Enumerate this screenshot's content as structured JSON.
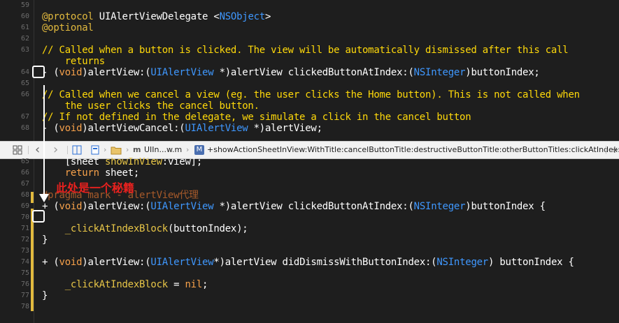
{
  "annotation": "此处是一个秘籍",
  "jumpbar": {
    "back": "‹",
    "forward": "›",
    "file_icon_letter": "m",
    "file": "UIIn...w.m",
    "method_icon_letter": "M",
    "method": "+showActionSheetInView:WithTitle:cancelButtonTitle:destructiveButtonTitle:otherButtonTitles:clickAtIndex:",
    "add": "+"
  },
  "top_lines": [
    {
      "n": "59",
      "t": []
    },
    {
      "n": "60",
      "t": [
        [
          "pp",
          "@protocol "
        ],
        [
          "pl",
          "UIAlertViewDelegate <"
        ],
        [
          "ty",
          "NSObject"
        ],
        [
          "pl",
          ">"
        ]
      ]
    },
    {
      "n": "61",
      "t": [
        [
          "pp",
          "@optional"
        ]
      ]
    },
    {
      "n": "62",
      "t": []
    },
    {
      "n": "63",
      "t": [
        [
          "cm",
          "// Called when a button is clicked. The view will be automatically dismissed after this call"
        ]
      ]
    },
    {
      "n": "",
      "t": [
        [
          "cm",
          "    returns"
        ]
      ]
    },
    {
      "n": "64",
      "t": [
        [
          "pl",
          "- ("
        ],
        [
          "kw",
          "void"
        ],
        [
          "pl",
          ")alertView:("
        ],
        [
          "ty",
          "UIAlertView"
        ],
        [
          "pl",
          " *)alertView clickedButtonAtIndex:("
        ],
        [
          "ty",
          "NSInteger"
        ],
        [
          "pl",
          ")buttonIndex;"
        ]
      ]
    },
    {
      "n": "65",
      "t": []
    },
    {
      "n": "66",
      "t": [
        [
          "cm",
          "// Called when we cancel a view (eg. the user clicks the Home button). This is not called when"
        ]
      ]
    },
    {
      "n": "",
      "t": [
        [
          "cm",
          "    the user clicks the cancel button."
        ]
      ]
    },
    {
      "n": "67",
      "t": [
        [
          "cm",
          "// If not defined in the delegate, we simulate a click in the cancel button"
        ]
      ]
    },
    {
      "n": "68",
      "t": [
        [
          "pl",
          "- ("
        ],
        [
          "kw",
          "void"
        ],
        [
          "pl",
          ")alertViewCancel:("
        ],
        [
          "ty",
          "UIAlertView"
        ],
        [
          "pl",
          " *)alertView;"
        ]
      ]
    }
  ],
  "bottom_lines": [
    {
      "n": "65",
      "t": [
        [
          "pl",
          "    [sheet "
        ],
        [
          "fn",
          "showInView"
        ],
        [
          "pl",
          ":view];"
        ]
      ]
    },
    {
      "n": "66",
      "t": [
        [
          "kw",
          "    return"
        ],
        [
          "pl",
          " sheet;"
        ]
      ]
    },
    {
      "n": "67",
      "t": []
    },
    {
      "n": "68",
      "t": [
        [
          "mk",
          "#pragma mark - alertView代理"
        ]
      ]
    },
    {
      "n": "69",
      "t": [
        [
          "pl",
          "+ ("
        ],
        [
          "kw",
          "void"
        ],
        [
          "pl",
          ")alertView:("
        ],
        [
          "ty",
          "UIAlertView"
        ],
        [
          "pl",
          " *)alertView clickedButtonAtIndex:("
        ],
        [
          "ty",
          "NSInteger"
        ],
        [
          "pl",
          ")buttonIndex {"
        ]
      ]
    },
    {
      "n": "70",
      "t": []
    },
    {
      "n": "71",
      "t": [
        [
          "fn",
          "    _clickAtIndexBlock"
        ],
        [
          "pl",
          "(buttonIndex);"
        ]
      ]
    },
    {
      "n": "72",
      "t": [
        [
          "pl",
          "}"
        ]
      ]
    },
    {
      "n": "73",
      "t": []
    },
    {
      "n": "74",
      "t": [
        [
          "pl",
          "+ ("
        ],
        [
          "kw",
          "void"
        ],
        [
          "pl",
          ")alertView:("
        ],
        [
          "ty",
          "UIAlertView"
        ],
        [
          "pl",
          "*)alertView didDismissWithButtonIndex:("
        ],
        [
          "ty",
          "NSInteger"
        ],
        [
          "pl",
          ") buttonIndex {"
        ]
      ]
    },
    {
      "n": "75",
      "t": []
    },
    {
      "n": "76",
      "t": [
        [
          "fn",
          "    _clickAtIndexBlock"
        ],
        [
          "pl",
          " = "
        ],
        [
          "kw",
          "nil"
        ],
        [
          "pl",
          ";"
        ]
      ]
    },
    {
      "n": "77",
      "t": [
        [
          "pl",
          "}"
        ]
      ]
    },
    {
      "n": "78",
      "t": []
    }
  ]
}
